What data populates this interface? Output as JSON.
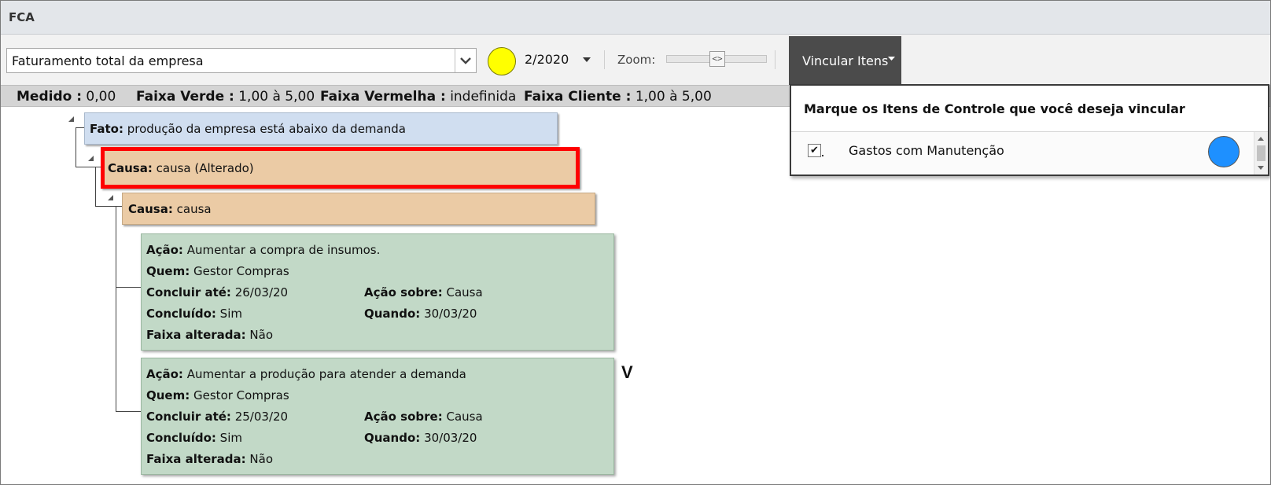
{
  "window": {
    "title": "FCA"
  },
  "toolbar": {
    "indicator_select_value": "Faturamento total da empresa",
    "status_color": "#ffff00",
    "period": "2/2020",
    "zoom_label": "Zoom:",
    "vincular_label": "Vincular Itens"
  },
  "info": {
    "medido_label": "Medido :",
    "medido_value": "0,00",
    "verde_label": "Faixa Verde :",
    "verde_value": "1,00 à 5,00",
    "vermelha_label": "Faixa Vermelha :",
    "vermelha_value": "indefinida",
    "cliente_label": "Faixa Cliente :",
    "cliente_value": "1,00 à 5,00"
  },
  "tree": {
    "fato": {
      "label": "Fato:",
      "text": "produção da empresa está abaixo da demanda"
    },
    "causa1": {
      "label": "Causa:",
      "text": "causa (Alterado)"
    },
    "causa2": {
      "label": "Causa:",
      "text": "causa"
    },
    "acoes": [
      {
        "acao_label": "Ação:",
        "acao": "Aumentar a compra de insumos.",
        "quem_label": "Quem:",
        "quem": "Gestor Compras",
        "concluir_label": "Concluir até:",
        "concluir": "26/03/20",
        "sobre_label": "Ação sobre:",
        "sobre": "Causa",
        "concluido_label": "Concluído:",
        "concluido": "Sim",
        "quando_label": "Quando:",
        "quando": "30/03/20",
        "faixa_label": "Faixa alterada:",
        "faixa": "Não"
      },
      {
        "acao_label": "Ação:",
        "acao": "Aumentar a produção para atender a demanda",
        "quem_label": "Quem:",
        "quem": "Gestor Compras",
        "concluir_label": "Concluir até:",
        "concluir": "25/03/20",
        "sobre_label": "Ação sobre:",
        "sobre": "Causa",
        "concluido_label": "Concluído:",
        "concluido": "Sim",
        "quando_label": "Quando:",
        "quando": "30/03/20",
        "faixa_label": "Faixa alterada:",
        "faixa": "Não"
      }
    ],
    "mark": "V"
  },
  "panel": {
    "heading": "Marque os Itens de Controle que você deseja vincular",
    "items": [
      {
        "label": "Gastos com Manutenção",
        "checked": true,
        "color": "#1e90ff",
        "checkmark": "✔"
      }
    ]
  }
}
